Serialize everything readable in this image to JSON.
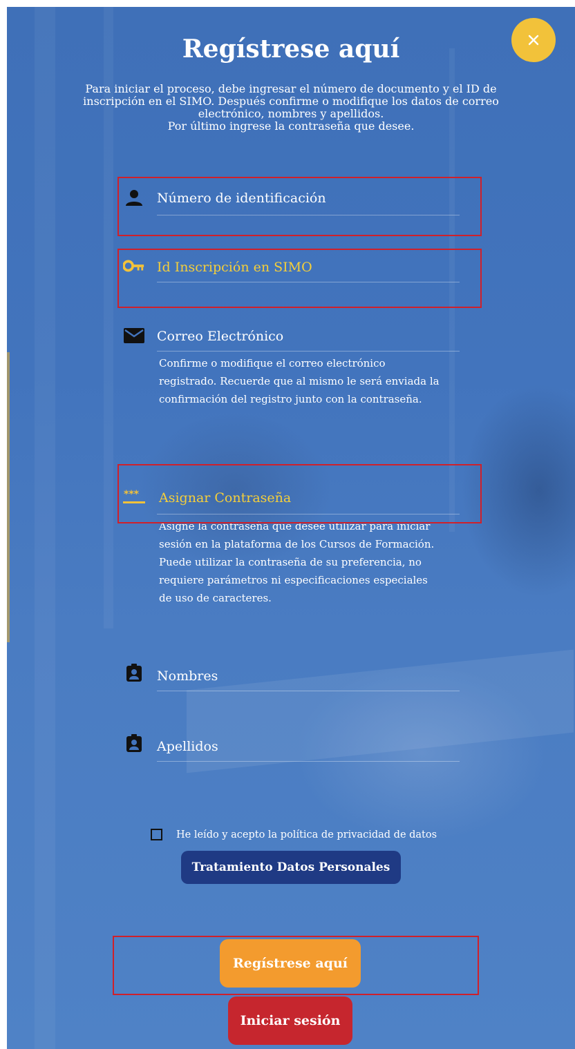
{
  "dialog": {
    "title": "Regístrese aquí",
    "intro_lines": [
      "Para iniciar el proceso, debe ingresar el número de documento y el ID de",
      "inscripción en el SIMO. Después confirme o modifique los datos de correo",
      "electrónico, nombres y apellidos.",
      "Por último ingrese la contraseña que desee."
    ]
  },
  "fields": {
    "identificacion": {
      "placeholder": "Número de identificación",
      "icon": "person-icon"
    },
    "simo": {
      "placeholder": "Id Inscripción en SIMO",
      "icon": "key-icon",
      "color": "#f5cf3a"
    },
    "correo": {
      "placeholder": "Correo Electrónico",
      "icon": "envelope-icon",
      "help_lines": [
        "Confirme o modifique el correo electrónico",
        "registrado. Recuerde que al mismo le será enviada la",
        "confirmación del registro junto con la contraseña."
      ]
    },
    "contrasena": {
      "placeholder": "Asignar Contraseña",
      "icon": "password-icon",
      "color": "#f5cf3a",
      "help_lines": [
        "Asigne la contraseña que desee utilizar para iniciar",
        "sesión en la plataforma de los Cursos de Formación.",
        "Puede utilizar la contraseña de su preferencia, no",
        "requiere parámetros ni especificaciones especiales",
        "de uso de caracteres."
      ]
    },
    "nombres": {
      "placeholder": "Nombres",
      "icon": "id-badge-icon"
    },
    "apellidos": {
      "placeholder": "Apellidos",
      "icon": "id-badge-icon"
    }
  },
  "consent": {
    "label": "He leído y acepto la política de privacidad de datos",
    "checked": false
  },
  "buttons": {
    "tratamiento": "Tratamiento Datos Personales",
    "registrar": "Regístrese aquí",
    "iniciar": "Iniciar sesión"
  },
  "colors": {
    "accent_yellow": "#f2c23a",
    "register_orange": "#f39b2e",
    "login_red": "#c6262e",
    "highlight_red": "#d0202a",
    "tdp_blue": "#1f3a84"
  }
}
